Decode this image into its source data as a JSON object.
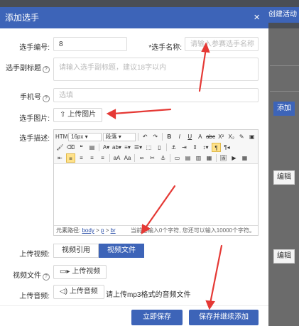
{
  "background": {
    "chip_label": "创建活动",
    "edit_label_1": "编辑",
    "edit_label_2": "编辑",
    "side_button_label": "添加"
  },
  "modal": {
    "title": "添加选手",
    "close_icon": "×",
    "fields": {
      "number": {
        "label": "选手编号:",
        "value": "8"
      },
      "name": {
        "label": "*选手名称:",
        "placeholder": "请输入参赛选手名称"
      },
      "subtitle": {
        "label": "选手副标题",
        "placeholder": "请输入选手副标题，建议18字以内"
      },
      "phone": {
        "label": "手机号",
        "placeholder": "选填"
      },
      "image": {
        "label": "选手图片:",
        "button": "上传图片"
      },
      "description": {
        "label": "选手描述:"
      },
      "video": {
        "label": "上传视频:",
        "options": [
          "视频引用",
          "视频文件"
        ],
        "selected": "视频文件"
      },
      "video_file": {
        "label": "视频文件",
        "button": "上传视频"
      },
      "audio": {
        "label": "上传音频:",
        "button": "上传音频",
        "note": "请上传mp3格式的音频文件"
      }
    },
    "editor": {
      "font_size": "16px",
      "paragraph": "段落",
      "path_label": "元素路径:",
      "path": [
        "body",
        "p",
        "br"
      ],
      "word_count": "当前已输入0个字符, 您还可以输入10000个字符。"
    },
    "footer": {
      "save_now": "立即保存",
      "save_continue": "保存并继续添加"
    }
  },
  "colors": {
    "primary": "#3d64b8",
    "arrow": "#e53935"
  }
}
